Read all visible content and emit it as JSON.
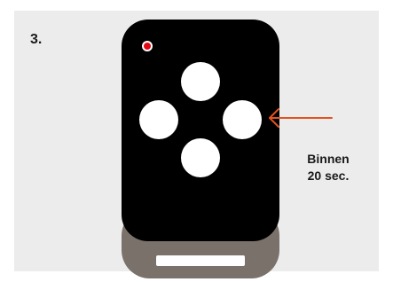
{
  "step_label": "3.",
  "caption": {
    "line1": "Binnen",
    "line2": "20 sec."
  },
  "colors": {
    "panel": "#ececec",
    "remote_body": "#000000",
    "remote_base": "#7a716b",
    "buttons": "#ffffff",
    "led": "#e30613",
    "arrow": "#e2531f"
  },
  "remote": {
    "button_count": 4,
    "highlighted_button": "right"
  }
}
